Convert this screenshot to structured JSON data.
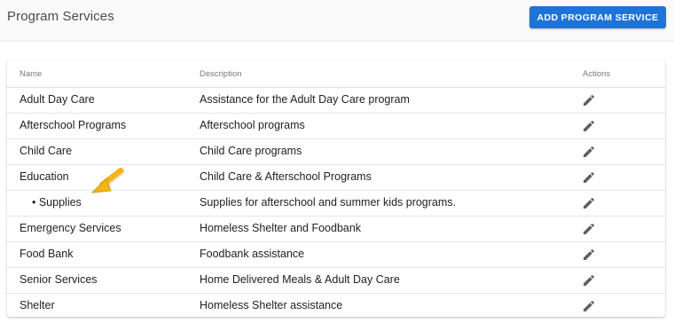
{
  "header": {
    "title": "Program Services",
    "add_button_label": "ADD PROGRAM SERVICE"
  },
  "table": {
    "columns": {
      "name": "Name",
      "description": "Description",
      "actions": "Actions"
    },
    "rows": [
      {
        "name": "Adult Day Care",
        "description": "Assistance for the Adult Day Care program",
        "child": false
      },
      {
        "name": "Afterschool Programs",
        "description": "Afterschool programs",
        "child": false
      },
      {
        "name": "Child Care",
        "description": "Child Care programs",
        "child": false
      },
      {
        "name": "Education",
        "description": "Child Care & Afterschool Programs",
        "child": false
      },
      {
        "name": "• Supplies",
        "description": "Supplies for afterschool and summer kids programs.",
        "child": true
      },
      {
        "name": "Emergency Services",
        "description": "Homeless Shelter and Foodbank",
        "child": false
      },
      {
        "name": "Food Bank",
        "description": "Foodbank assistance",
        "child": false
      },
      {
        "name": "Senior Services",
        "description": "Home Delivered Meals & Adult Day Care",
        "child": false
      },
      {
        "name": "Shelter",
        "description": "Homeless Shelter assistance",
        "child": false
      }
    ],
    "action_icon": "pencil-icon"
  },
  "annotation": {
    "icon": "arrow-pointer-icon",
    "color": "#f2b418"
  },
  "colors": {
    "accent": "#1e74d6"
  }
}
